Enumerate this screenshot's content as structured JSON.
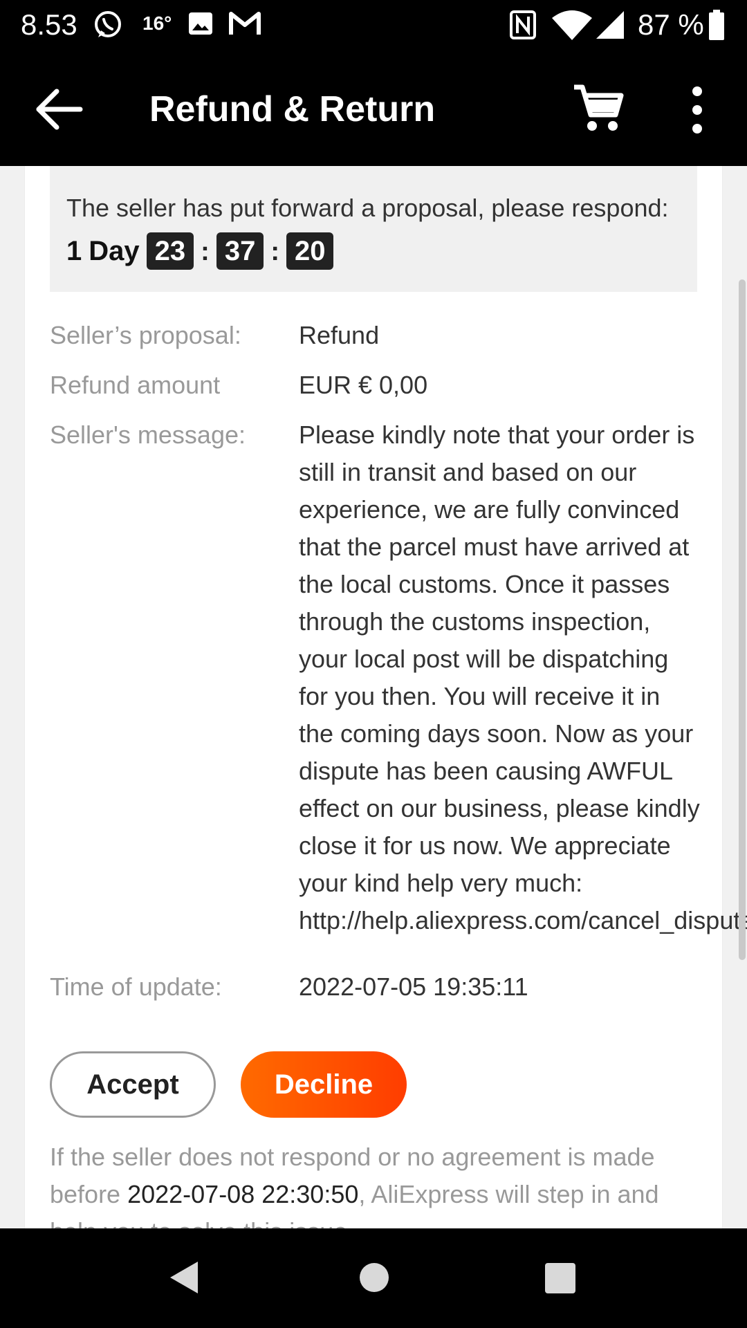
{
  "status_bar": {
    "time": "8.53",
    "temperature": "16°",
    "battery_percent": "87 %",
    "icons": [
      "whatsapp-icon",
      "image-icon",
      "gmail-icon",
      "nfc-icon",
      "wifi-icon",
      "signal-icon",
      "battery-icon"
    ]
  },
  "app_bar": {
    "title": "Refund & Return",
    "icons": [
      "back-arrow-icon",
      "cart-icon",
      "more-vert-icon"
    ]
  },
  "notice": {
    "text_before": "The seller has put forward a proposal, please respond:",
    "day_count": "1",
    "day_label": "Day",
    "hours": "23",
    "minutes": "37",
    "seconds": "20"
  },
  "details": {
    "proposal_label": "Seller’s proposal:",
    "proposal_value": "Refund",
    "amount_label": "Refund amount",
    "amount_value": "EUR € 0,00",
    "message_label": "Seller's message:",
    "message_value": "Please kindly note that your order is still in transit and based on our experience, we are fully convinced that the parcel must have arrived at the local customs. Once it passes through the customs inspection, your local post will be dispatching for you then. You will receive it in the coming days soon. Now as your dispute has been causing AWFUL effect on our business, please kindly close it for us now. We appreciate your kind help very much: http://help.aliexpress.com/cancel_dispute.html.",
    "update_label": "Time of update:",
    "update_value": "2022-07-05 19:35:11"
  },
  "actions": {
    "accept_label": "Accept",
    "decline_label": "Decline"
  },
  "footer": {
    "before": "If the seller does not respond or no agreement is made before ",
    "deadline": "2022-07-08 22:30:50",
    "after": ", AliExpress will step in and help you to solve this issue."
  },
  "colors": {
    "accent": "#ff4e00",
    "label_gray": "#999999",
    "bar_black": "#000000"
  }
}
